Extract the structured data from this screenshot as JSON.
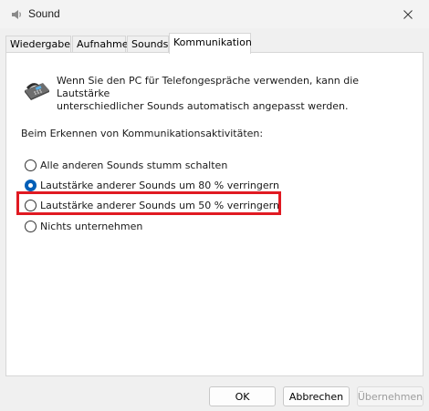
{
  "window": {
    "title": "Sound",
    "close_icon": "close-icon"
  },
  "tabs": [
    {
      "label": "Wiedergabe",
      "active": false
    },
    {
      "label": "Aufnahme",
      "active": false
    },
    {
      "label": "Sounds",
      "active": false
    },
    {
      "label": "Kommunikation",
      "active": true
    }
  ],
  "communication": {
    "icon": "telephone-icon",
    "intro_line1": "Wenn Sie den PC für Telefongespräche verwenden, kann die Lautstärke",
    "intro_line2": "unterschiedlicher Sounds automatisch angepasst werden.",
    "section_label": "Beim Erkennen von Kommunikationsaktivitäten:",
    "options": [
      {
        "label": "Alle anderen Sounds stumm schalten",
        "checked": false
      },
      {
        "label": "Lautstärke anderer Sounds um 80 % verringern",
        "checked": true
      },
      {
        "label": "Lautstärke anderer Sounds um 50 % verringern",
        "checked": false
      },
      {
        "label": "Nichts unternehmen",
        "checked": false
      }
    ],
    "highlight_color": "#e01a22"
  },
  "buttons": {
    "ok": "OK",
    "cancel": "Abbrechen",
    "apply": "Übernehmen"
  },
  "colors": {
    "accent": "#005fb8"
  }
}
